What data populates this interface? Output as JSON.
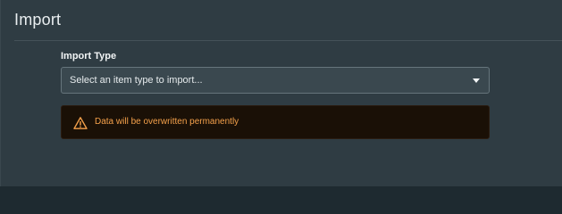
{
  "header": {
    "title": "Import"
  },
  "form": {
    "import_type_label": "Import Type",
    "import_type_value": "Select an item type to import...",
    "select_caret_icon": "chevron-down-icon"
  },
  "alert": {
    "icon": "warning-triangle-icon",
    "message": "Data will be overwritten permanently",
    "color": "#f5a14b",
    "background": "#1a1006"
  }
}
